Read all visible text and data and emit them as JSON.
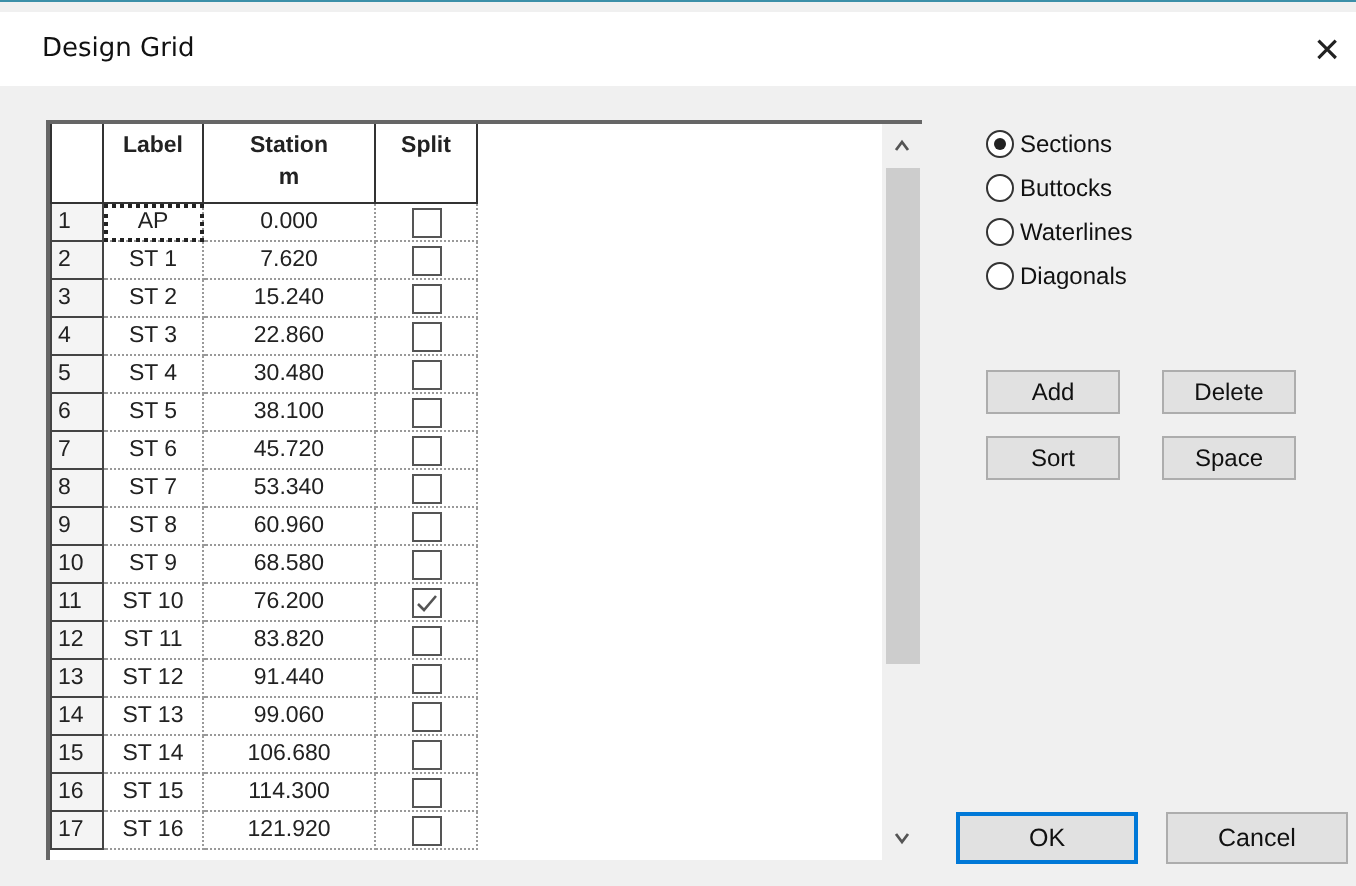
{
  "window": {
    "title": "Design Grid",
    "close": "×"
  },
  "grid": {
    "columns": [
      "Label",
      "Station",
      "Split"
    ],
    "station_unit": "m",
    "rows": [
      {
        "number": "1",
        "label": "AP",
        "station": "0.000",
        "split": false,
        "selected": true
      },
      {
        "number": "2",
        "label": "ST 1",
        "station": "7.620",
        "split": false,
        "selected": false
      },
      {
        "number": "3",
        "label": "ST 2",
        "station": "15.240",
        "split": false,
        "selected": false
      },
      {
        "number": "4",
        "label": "ST 3",
        "station": "22.860",
        "split": false,
        "selected": false
      },
      {
        "number": "5",
        "label": "ST 4",
        "station": "30.480",
        "split": false,
        "selected": false
      },
      {
        "number": "6",
        "label": "ST 5",
        "station": "38.100",
        "split": false,
        "selected": false
      },
      {
        "number": "7",
        "label": "ST 6",
        "station": "45.720",
        "split": false,
        "selected": false
      },
      {
        "number": "8",
        "label": "ST 7",
        "station": "53.340",
        "split": false,
        "selected": false
      },
      {
        "number": "9",
        "label": "ST 8",
        "station": "60.960",
        "split": false,
        "selected": false
      },
      {
        "number": "10",
        "label": "ST 9",
        "station": "68.580",
        "split": false,
        "selected": false
      },
      {
        "number": "11",
        "label": "ST 10",
        "station": "76.200",
        "split": true,
        "selected": false
      },
      {
        "number": "12",
        "label": "ST 11",
        "station": "83.820",
        "split": false,
        "selected": false
      },
      {
        "number": "13",
        "label": "ST 12",
        "station": "91.440",
        "split": false,
        "selected": false
      },
      {
        "number": "14",
        "label": "ST 13",
        "station": "99.060",
        "split": false,
        "selected": false
      },
      {
        "number": "15",
        "label": "ST 14",
        "station": "106.680",
        "split": false,
        "selected": false
      },
      {
        "number": "16",
        "label": "ST 15",
        "station": "114.300",
        "split": false,
        "selected": false
      },
      {
        "number": "17",
        "label": "ST 16",
        "station": "121.920",
        "split": false,
        "selected": false
      }
    ]
  },
  "modes": [
    {
      "label": "Sections",
      "selected": true
    },
    {
      "label": "Buttocks",
      "selected": false
    },
    {
      "label": "Waterlines",
      "selected": false
    },
    {
      "label": "Diagonals",
      "selected": false
    }
  ],
  "actions": [
    "Add",
    "Delete",
    "Sort",
    "Space"
  ],
  "buttons": [
    {
      "label": "OK",
      "default": true
    },
    {
      "label": "Cancel",
      "default": false
    }
  ]
}
